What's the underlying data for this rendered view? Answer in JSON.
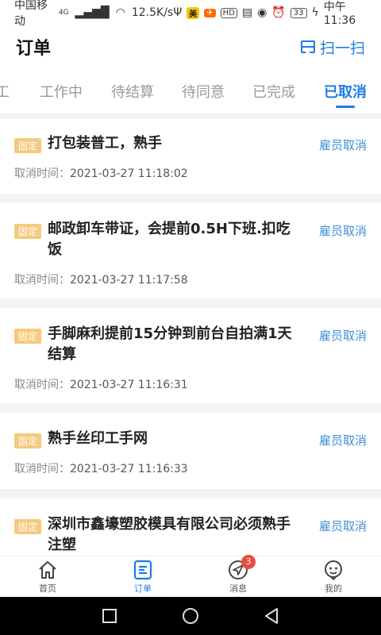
{
  "statusbar": {
    "carrier": "中国移动",
    "network": "4G",
    "speed": "12.5K/s",
    "badge_mei": "美",
    "badge_hd": "HD",
    "battery": "33",
    "time": "中午11:36"
  },
  "header": {
    "title": "订单",
    "scan_label": "扫一扫"
  },
  "tabs": [
    {
      "label": "工",
      "active": false
    },
    {
      "label": "工作中",
      "active": false
    },
    {
      "label": "待结算",
      "active": false
    },
    {
      "label": "待同意",
      "active": false
    },
    {
      "label": "已完成",
      "active": false
    },
    {
      "label": "已取消",
      "active": true
    }
  ],
  "orders": [
    {
      "tag": "固定",
      "title": "打包装普工，熟手",
      "status": "雇员取消",
      "time_label": "取消时间：",
      "time": "2021-03-27 11:18:02"
    },
    {
      "tag": "固定",
      "title": "邮政卸车带证，会提前0.5H下班.扣吃饭",
      "status": "雇员取消",
      "time_label": "取消时间：",
      "time": "2021-03-27 11:17:58"
    },
    {
      "tag": "固定",
      "title": "手脚麻利提前15分钟到前台自拍满1天结算",
      "status": "雇员取消",
      "time_label": "取消时间：",
      "time": "2021-03-27 11:16:31"
    },
    {
      "tag": "固定",
      "title": "熟手丝印工手网",
      "status": "雇员取消",
      "time_label": "取消时间：",
      "time": "2021-03-27 11:16:33"
    },
    {
      "tag": "固定",
      "title": "深圳市鑫壕塑胶模具有限公司必须熟手注塑",
      "status": "雇员取消",
      "time_label": "",
      "time": ""
    }
  ],
  "bottomnav": {
    "home": "首页",
    "orders": "订单",
    "messages": "消息",
    "messages_badge": "3",
    "mine": "我的"
  },
  "colors": {
    "accent": "#1e7be6",
    "tag": "#f6c97e",
    "status": "#3f8fd8",
    "badge": "#ee4b3d"
  }
}
